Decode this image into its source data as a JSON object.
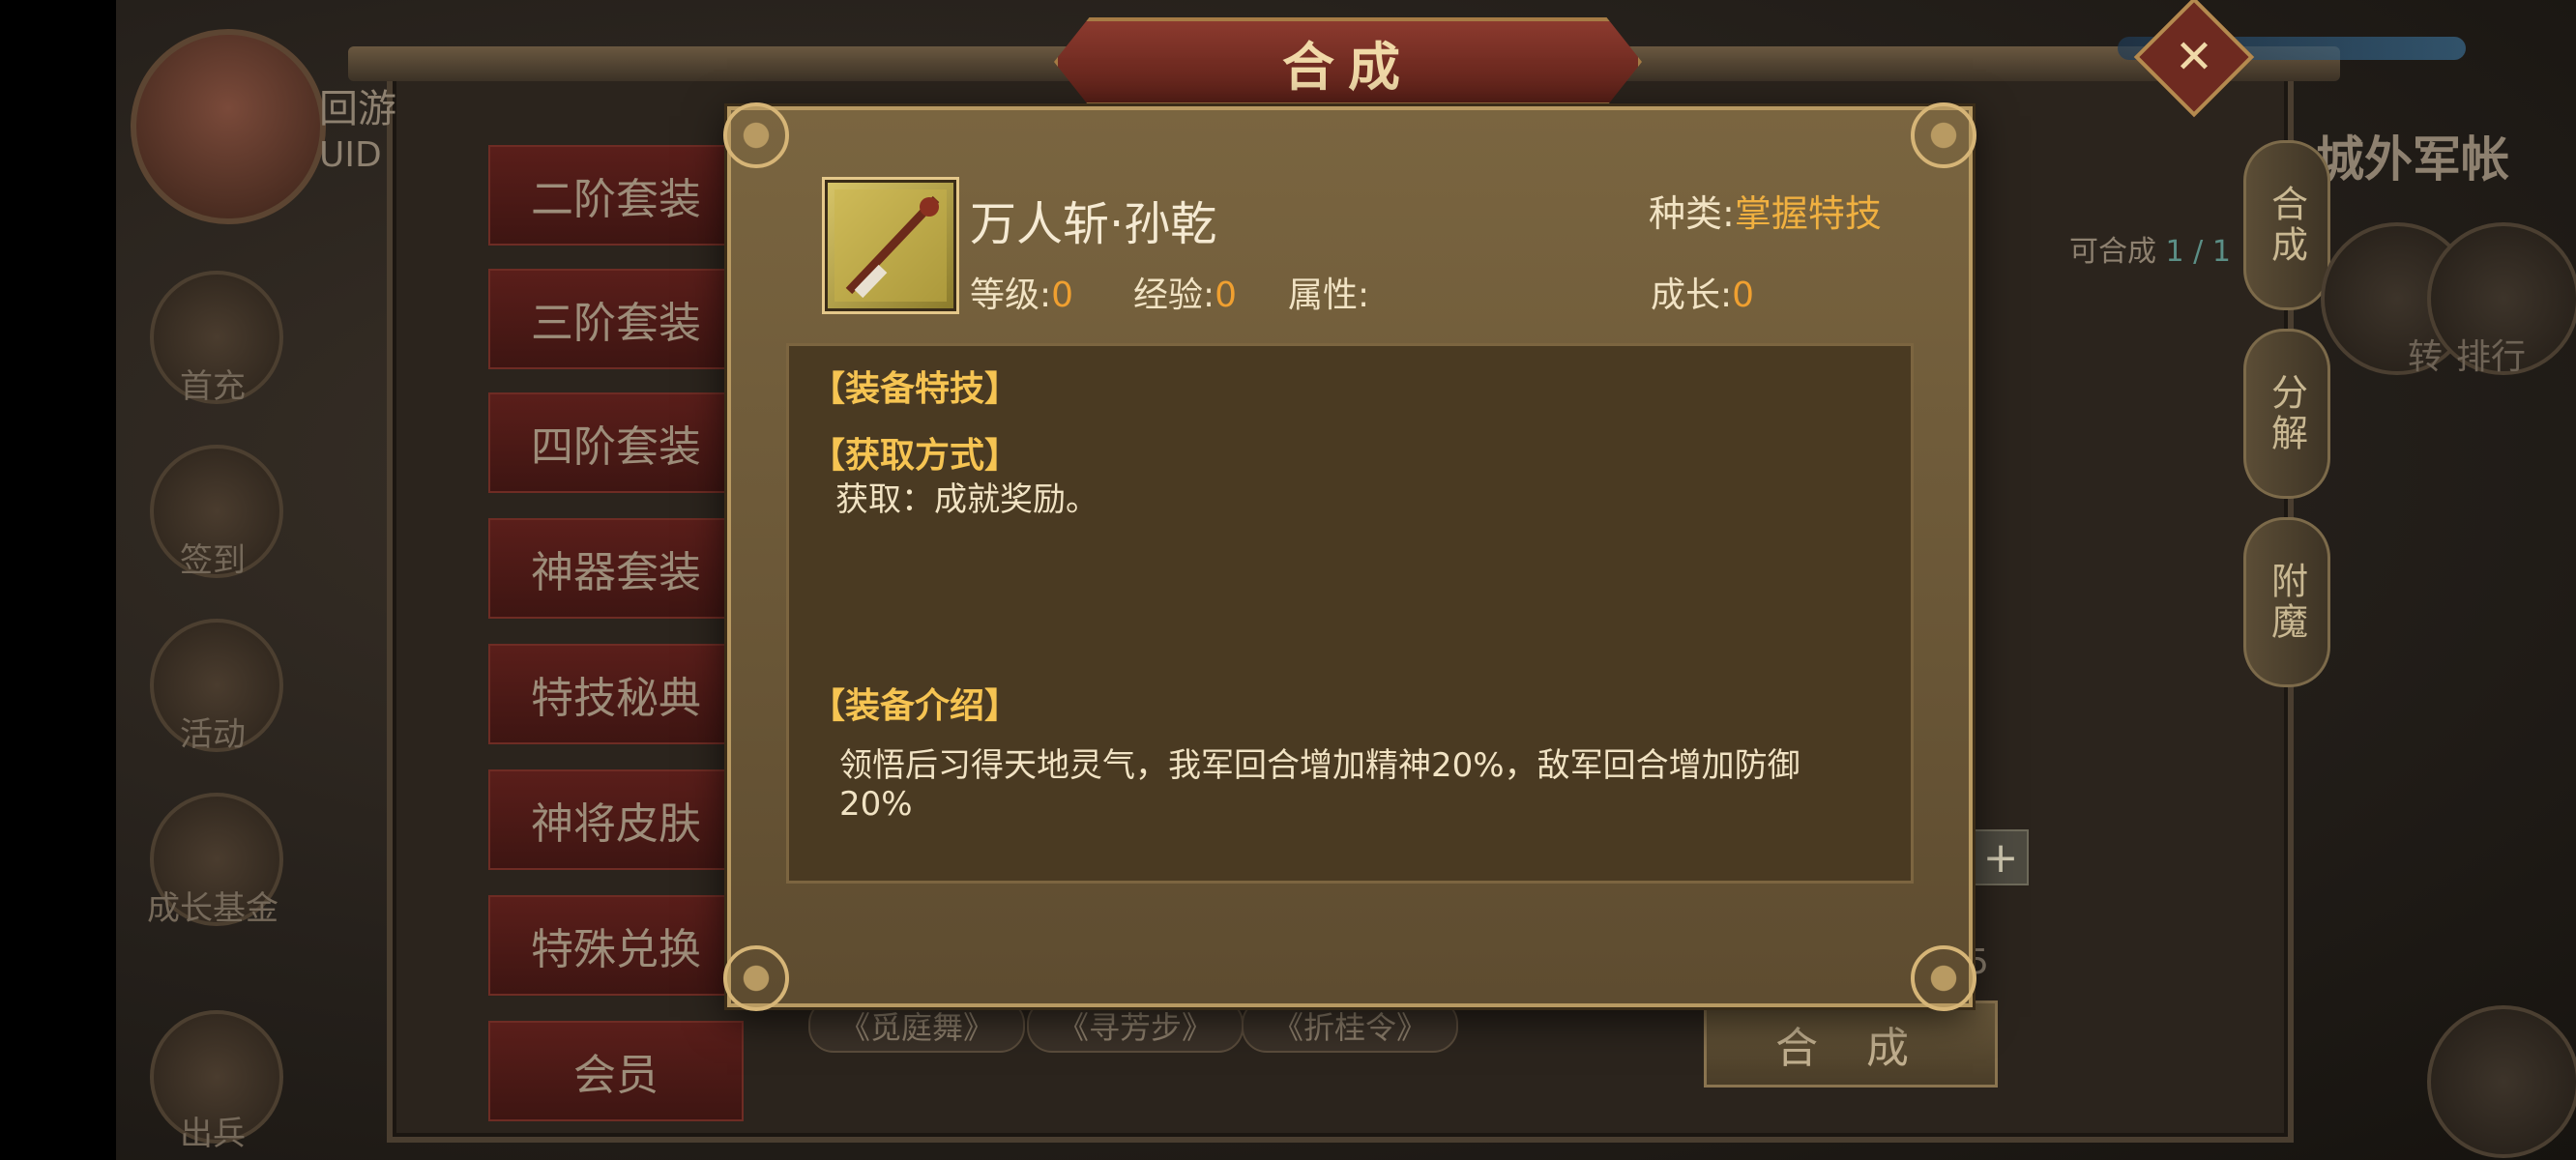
{
  "window": {
    "title": "合成",
    "close_label": "✕"
  },
  "player": {
    "name": "回游",
    "uid_label": "UID"
  },
  "side_menu": [
    {
      "label": "首充"
    },
    {
      "label": "签到"
    },
    {
      "label": "活动"
    },
    {
      "label": "成长基金"
    },
    {
      "label": "出兵"
    }
  ],
  "categories": [
    {
      "label": "二阶套装"
    },
    {
      "label": "三阶套装"
    },
    {
      "label": "四阶套装"
    },
    {
      "label": "神器套装"
    },
    {
      "label": "特技秘典"
    },
    {
      "label": "神将皮肤"
    },
    {
      "label": "特殊兑换"
    },
    {
      "label": "会员"
    }
  ],
  "skill_tags": [
    "《觅庭舞》",
    "《寻芳步》",
    "《折桂令》"
  ],
  "compose_button": "合 成",
  "quantity_suffix": "5",
  "right_panel": {
    "title": "城外军帐",
    "composable_label": "可合成",
    "composable_value": "1 / 1",
    "tabs": [
      "合成",
      "分解",
      "附魔"
    ],
    "icon_labels": [
      "转",
      "排行"
    ]
  },
  "dialog": {
    "item_name": "万人斩·孙乾",
    "kind_label": "种类:",
    "kind_value": "掌握特技",
    "level_label": "等级:",
    "level_value": "0",
    "exp_label": "经验:",
    "exp_value": "0",
    "attr_label": "属性:",
    "growth_label": "成长:",
    "growth_value": "0",
    "sections": {
      "skill_heading": "【装备特技】",
      "source_heading": "【获取方式】",
      "source_text": "获取：成就奖励。",
      "intro_heading": "【装备介绍】",
      "intro_text": "领悟后习得天地灵气，我军回合增加精神20%，敌军回合增加防御20%"
    }
  },
  "colors": {
    "accent_gold": "#f6c452",
    "value_orange": "#f0a030",
    "dialog_bg": "#6b5636",
    "panel_bg": "#4a3a22"
  }
}
